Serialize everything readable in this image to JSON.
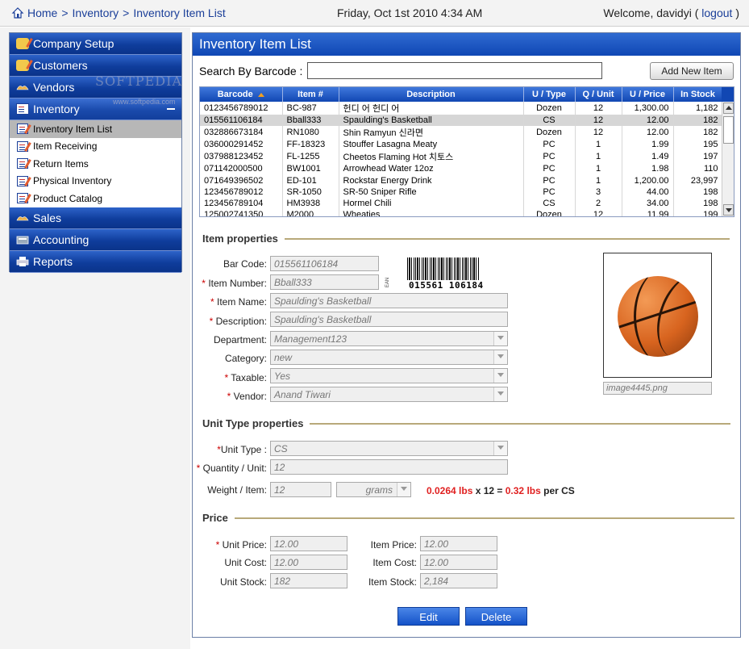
{
  "header": {
    "breadcrumb": [
      "Home",
      "Inventory",
      "Inventory Item List"
    ],
    "separator": ">",
    "datetime": "Friday, Oct 1st 2010 4:34 AM",
    "welcome_prefix": "Welcome, davidyi (",
    "logout": "logout",
    "welcome_suffix": ")"
  },
  "sidebar": {
    "sections": [
      "Company Setup",
      "Customers",
      "Vendors",
      "Inventory",
      "Sales",
      "Accounting",
      "Reports"
    ],
    "inventory_items": [
      "Inventory Item List",
      "Item Receiving",
      "Return Items",
      "Physical Inventory",
      "Product Catalog"
    ],
    "watermark": "SOFTPEDIA",
    "watermark_url": "www.softpedia.com"
  },
  "main": {
    "title": "Inventory Item List",
    "search_label": "Search By Barcode :",
    "search_value": "",
    "add_button": "Add New Item",
    "columns": [
      "Barcode",
      "Item #",
      "Description",
      "U / Type",
      "Q / Unit",
      "U / Price",
      "In Stock"
    ],
    "rows": [
      [
        "0123456789012",
        "BC-987",
        "헌디 어 헌디 어",
        "Dozen",
        "12",
        "1,300.00",
        "1,182"
      ],
      [
        "015561106184",
        "Bball333",
        "Spaulding's Basketball",
        "CS",
        "12",
        "12.00",
        "182"
      ],
      [
        "032886673184",
        "RN1080",
        "Shin Ramyun 신라면",
        "Dozen",
        "12",
        "12.00",
        "182"
      ],
      [
        "036000291452",
        "FF-18323",
        "Stouffer Lasagna Meaty",
        "PC",
        "1",
        "1.99",
        "195"
      ],
      [
        "037988123452",
        "FL-1255",
        "Cheetos Flaming Hot 치토스",
        "PC",
        "1",
        "1.49",
        "197"
      ],
      [
        "071142000500",
        "BW1001",
        "Arrowhead Water 12oz",
        "PC",
        "1",
        "1.98",
        "110"
      ],
      [
        "071649396502",
        "ED-101",
        "Rockstar Energy Drink",
        "PC",
        "1",
        "1,200.00",
        "23,997"
      ],
      [
        "123456789012",
        "SR-1050",
        "SR-50 Sniper Rifle",
        "PC",
        "3",
        "44.00",
        "198"
      ],
      [
        "123456789104",
        "HM3938",
        "Hormel Chili",
        "CS",
        "2",
        "34.00",
        "198"
      ],
      [
        "125002741350",
        "M2000",
        "Wheaties",
        "Dozen",
        "12",
        "11.99",
        "199"
      ]
    ]
  },
  "item_properties": {
    "heading": "Item properties",
    "labels": {
      "barcode": "Bar Code:",
      "item_number": "Item Number:",
      "item_name": "Item Name:",
      "description": "Description:",
      "department": "Department:",
      "category": "Category:",
      "taxable": "Taxable:",
      "vendor": "Vendor:"
    },
    "values": {
      "barcode": "015561106184",
      "item_number": "Bball333",
      "item_name": "Spaulding's Basketball",
      "description": "Spaulding's Basketball",
      "department": "Management123",
      "category": "new",
      "taxable": "Yes",
      "vendor": "Anand Tiwari"
    },
    "barcode_digits": "015561 106184",
    "barcode_type": "EAN",
    "image_name": "image4445.png"
  },
  "unit_type": {
    "heading": "Unit Type properties",
    "labels": {
      "unit_type": "Unit Type :",
      "quantity": "Quantity / Unit:",
      "weight": "Weight / Item:"
    },
    "values": {
      "unit_type": "CS",
      "quantity": "12",
      "weight": "12",
      "weight_unit": "grams"
    },
    "weight_note": {
      "lbs_item": "0.0264 lbs",
      "mult": " x 12 = ",
      "lbs_total": "0.32 lbs",
      "per": " per CS"
    }
  },
  "price": {
    "heading": "Price",
    "labels": {
      "unit_price": "Unit Price:",
      "unit_cost": "Unit Cost:",
      "unit_stock": "Unit Stock:",
      "item_price": "Item Price:",
      "item_cost": "Item Cost:",
      "item_stock": "Item Stock:"
    },
    "values": {
      "unit_price": "12.00",
      "unit_cost": "12.00",
      "unit_stock": "182",
      "item_price": "12.00",
      "item_cost": "12.00",
      "item_stock": "2,184"
    }
  },
  "actions": {
    "edit": "Edit",
    "delete": "Delete"
  },
  "colors": {
    "nav_blue": "#0f3d9c",
    "link_blue": "#1b3f99",
    "required_red": "#cc0000",
    "weight_red": "#e02020"
  }
}
